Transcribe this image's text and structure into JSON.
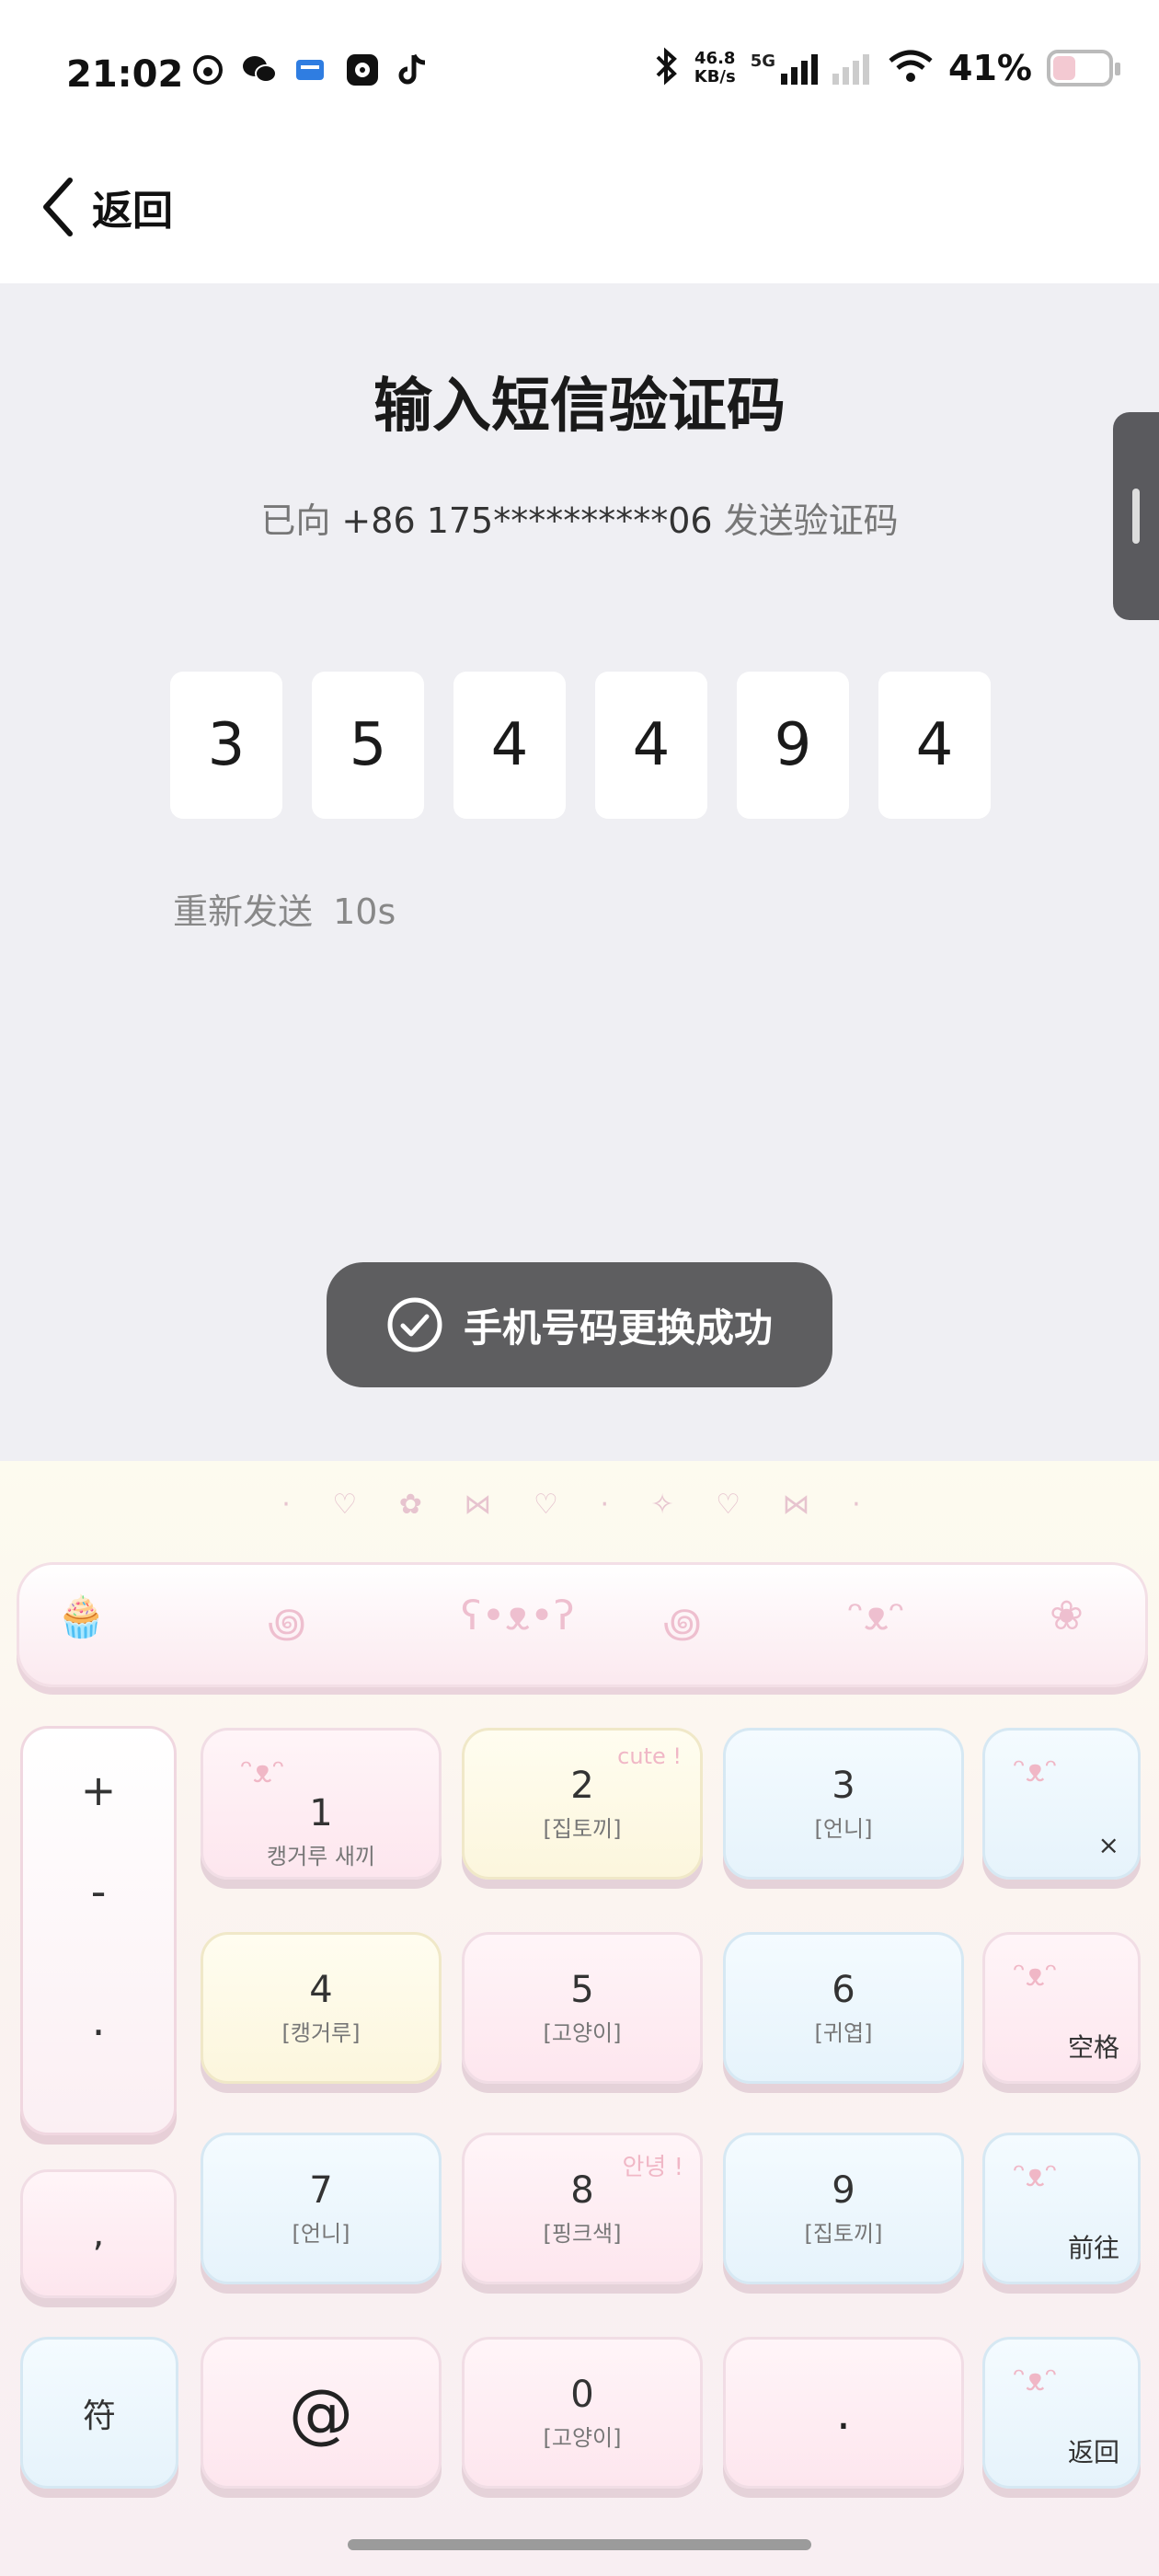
{
  "status_bar": {
    "time": "21:02",
    "net_speed_value": "46.8",
    "net_speed_unit": "KB/s",
    "network": "5G",
    "battery_percent": "41%",
    "battery_level": 0.41,
    "left_icons": [
      "weibo-icon",
      "wechat-icon",
      "message-icon",
      "gallery-icon",
      "tiktok-icon"
    ],
    "right_icons": [
      "bluetooth-icon",
      "signal-icon",
      "wifi-icon",
      "battery-icon"
    ]
  },
  "nav": {
    "back_label": "返回"
  },
  "main": {
    "title": "输入短信验证码",
    "subtitle_prefix": "已向",
    "phone": "+86 175**********06",
    "subtitle_suffix": "发送验证码",
    "code_digits": [
      "3",
      "5",
      "4",
      "4",
      "9",
      "4"
    ],
    "resend_label": "重新发送",
    "resend_countdown": "10s"
  },
  "toast": {
    "text": "手机号码更换成功"
  },
  "keyboard": {
    "symbols": [
      "+",
      "-",
      ".",
      ","
    ],
    "rows": [
      [
        {
          "main": "1",
          "sub": "캥거루 새끼"
        },
        {
          "main": "2",
          "sub": "[집토끼]"
        },
        {
          "main": "3",
          "sub": "[언니]"
        },
        {
          "main": "",
          "sub": "",
          "corner": "×"
        }
      ],
      [
        {
          "main": "4",
          "sub": "[캥거루]"
        },
        {
          "main": "5",
          "sub": "[고양이]"
        },
        {
          "main": "6",
          "sub": "[귀엽]"
        },
        {
          "main": "",
          "sub": "",
          "corner": "空格"
        }
      ],
      [
        {
          "main": "7",
          "sub": "[언니]"
        },
        {
          "main": "8",
          "sub": "[핑크색]"
        },
        {
          "main": "9",
          "sub": "[집토끼]"
        },
        {
          "main": "",
          "sub": "",
          "corner": "前往"
        }
      ]
    ],
    "bottom": {
      "symbol_label": "符",
      "at_label": "@",
      "zero_main": "0",
      "zero_sub": "[고양이]",
      "dot_label": ".",
      "return_label": "返回"
    },
    "sticker_texts": [
      "cute !",
      "안녕 !"
    ]
  }
}
